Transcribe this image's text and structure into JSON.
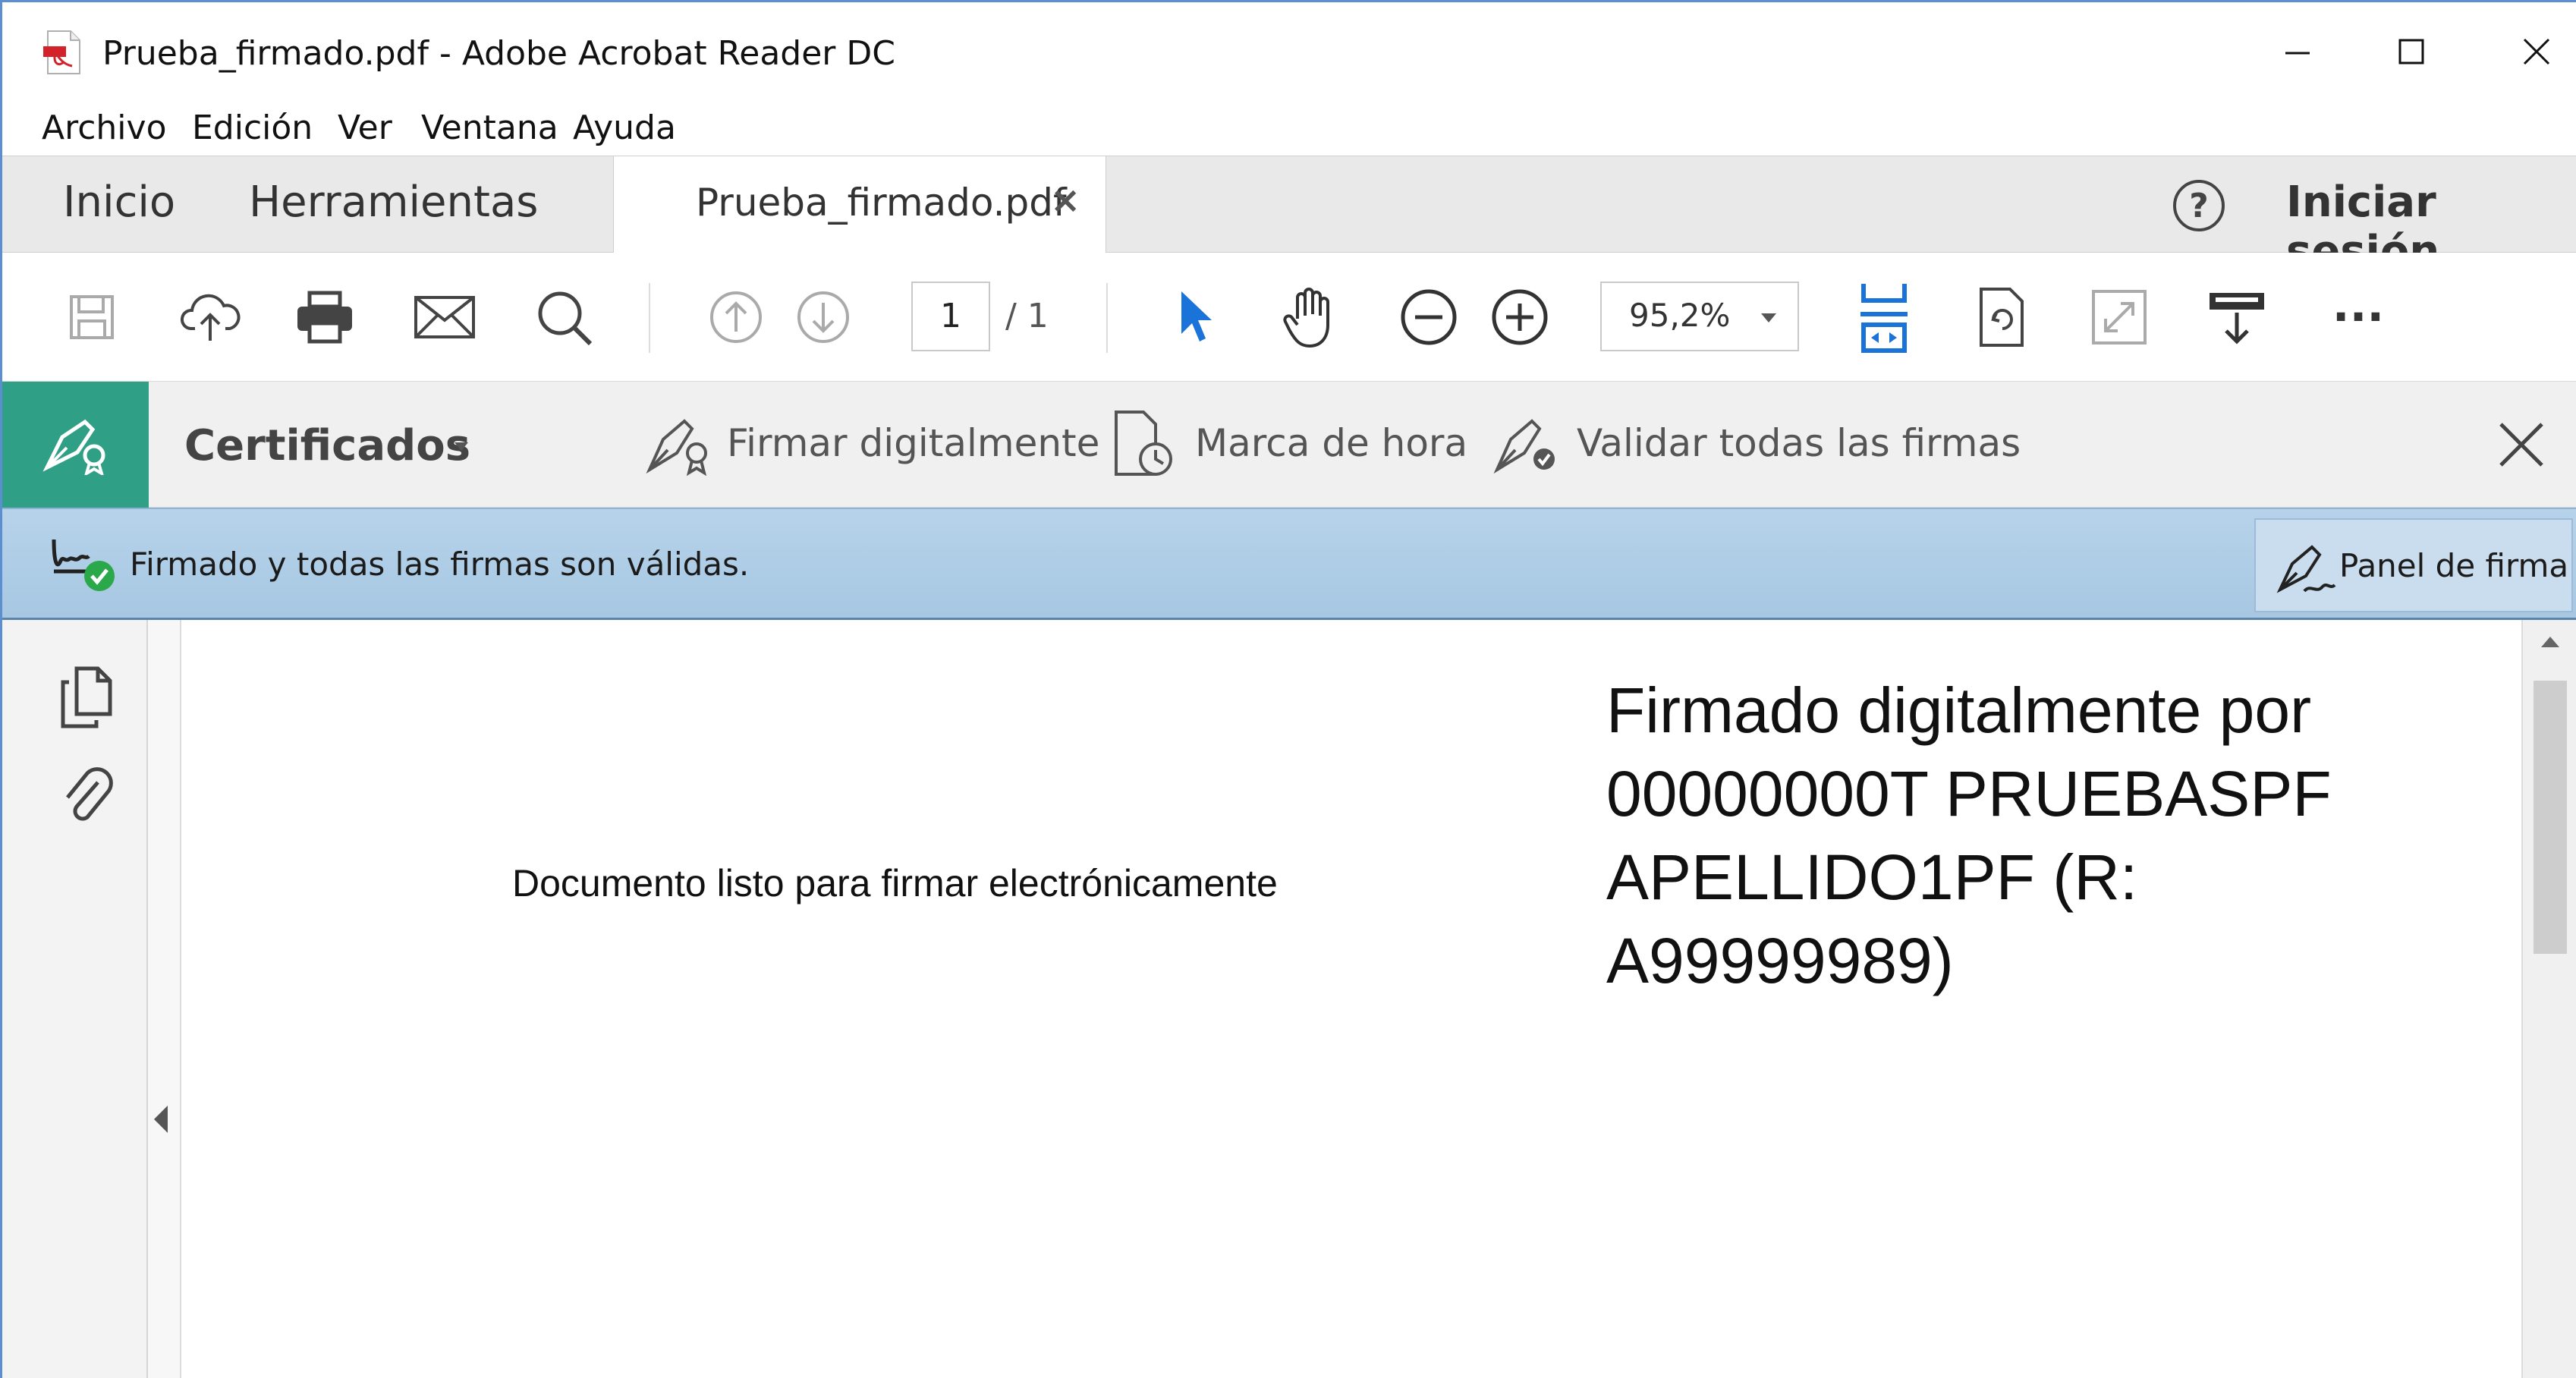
{
  "window": {
    "title": "Prueba_firmado.pdf - Adobe Acrobat Reader DC",
    "controls": {
      "minimize_icon": "minimize-icon",
      "maximize_icon": "maximize-icon",
      "close_icon": "close-icon"
    }
  },
  "menu": {
    "items": [
      "Archivo",
      "Edición",
      "Ver",
      "Ventana",
      "Ayuda"
    ]
  },
  "tabs": {
    "home": "Inicio",
    "tools": "Herramientas",
    "document": "Prueba_firmado.pdf",
    "document_close": "×",
    "help_icon": "help-icon",
    "sign_in": "Iniciar sesión"
  },
  "toolbar": {
    "page_current": "1",
    "page_total": "/ 1",
    "zoom": "95,2%",
    "icons": [
      "save-icon",
      "cloud-upload-icon",
      "print-icon",
      "email-icon",
      "search-icon",
      "previous-page-icon",
      "next-page-icon",
      "select-pointer-icon",
      "hand-tool-icon",
      "zoom-out-icon",
      "zoom-in-icon",
      "fit-page-icon",
      "rotate-icon",
      "full-screen-icon",
      "read-mode-icon",
      "more-icon"
    ],
    "more": "···"
  },
  "certificates": {
    "title": "Certificados",
    "sign_digitally": "Firmar digitalmente",
    "timestamp": "Marca de hora",
    "validate_all": "Validar todas las firmas"
  },
  "signature_bar": {
    "status": "Firmado y todas las firmas son válidas.",
    "panel_button": "Panel de firma"
  },
  "document": {
    "body_text": "Documento listo para firmar electrónicamente",
    "signature_lines": [
      "Firmado digitalmente por",
      "00000000T PRUEBASPF",
      "APELLIDO1PF (R:",
      "A99999989)"
    ]
  },
  "colors": {
    "cert_accent": "#2f9f86",
    "signature_bar": "#b6d3ea",
    "selection_blue": "#1a73d9"
  }
}
